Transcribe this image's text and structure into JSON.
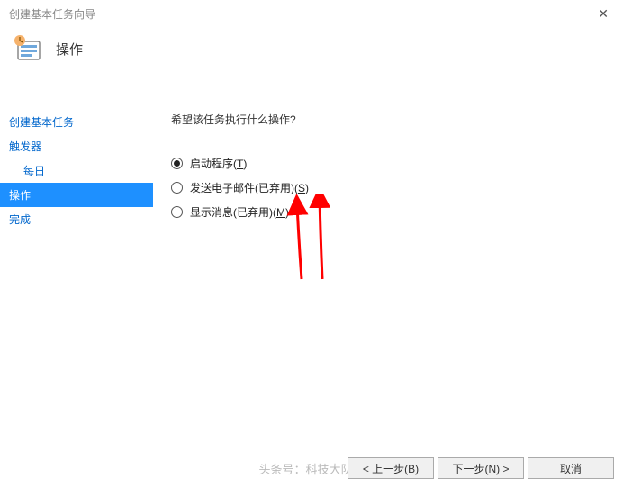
{
  "window": {
    "title": "创建基本任务向导"
  },
  "header": {
    "page_title": "操作"
  },
  "sidebar": {
    "items": [
      {
        "label": "创建基本任务",
        "selected": false,
        "sub": false
      },
      {
        "label": "触发器",
        "selected": false,
        "sub": false
      },
      {
        "label": "每日",
        "selected": false,
        "sub": true
      },
      {
        "label": "操作",
        "selected": true,
        "sub": false
      },
      {
        "label": "完成",
        "selected": false,
        "sub": false
      }
    ]
  },
  "main": {
    "prompt": "希望该任务执行什么操作?",
    "options": [
      {
        "label_pre": "启动程序(",
        "accel": "T",
        "label_post": ")",
        "checked": true
      },
      {
        "label_pre": "发送电子邮件(已弃用)(",
        "accel": "S",
        "label_post": ")",
        "checked": false
      },
      {
        "label_pre": "显示消息(已弃用)(",
        "accel": "M",
        "label_post": ")",
        "checked": false
      }
    ]
  },
  "footer": {
    "back": "< 上一步(B)",
    "next": "下一步(N) >",
    "cancel": "取消"
  },
  "watermark": "头条号：科技大队长"
}
